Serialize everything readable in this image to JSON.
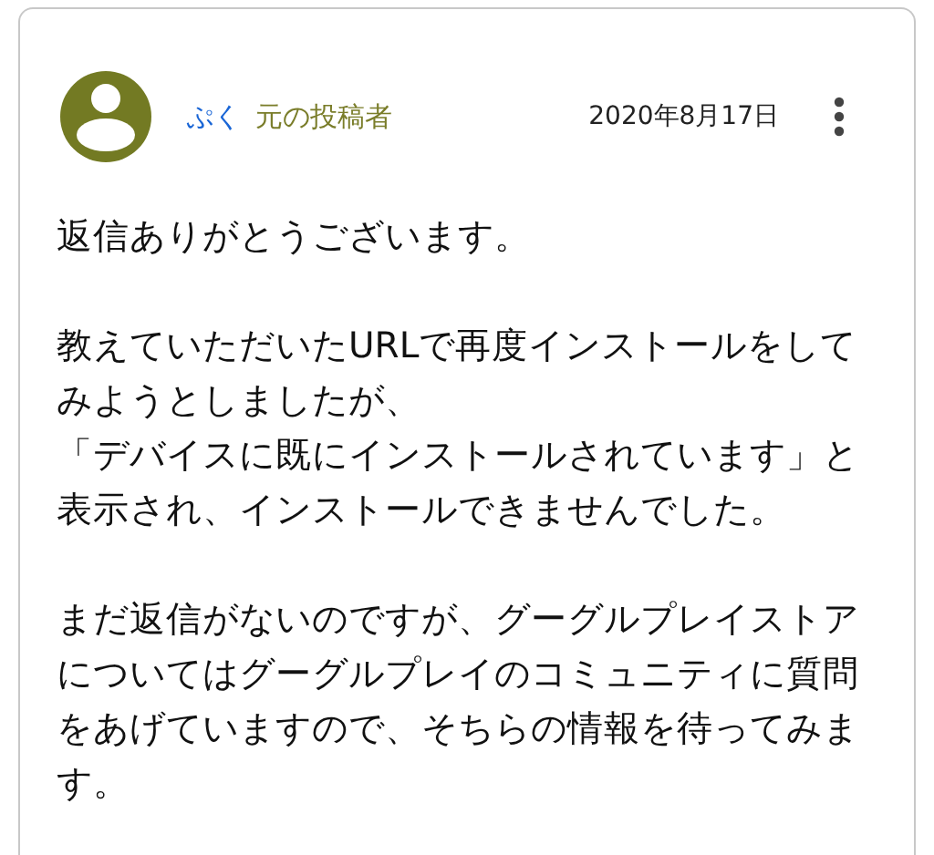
{
  "post": {
    "author": "ぷく",
    "badge": "元の投稿者",
    "date": "2020年8月17日",
    "paragraphs": [
      {
        "lines": [
          "返信ありがとうございます。"
        ]
      },
      {
        "lines": [
          "教えていただいたURLで再度インストールをして",
          "みようとしましたが、",
          "「デバイスに既にインストールされています」と",
          "表示され、インストールできませんでした。"
        ]
      },
      {
        "lines": [
          "まだ返信がないのですが、グーグルプレイストア",
          "についてはグーグルプレイのコミュニティに質問",
          "をあげていますので、そちらの情報を待ってみま",
          "す。"
        ]
      }
    ]
  }
}
